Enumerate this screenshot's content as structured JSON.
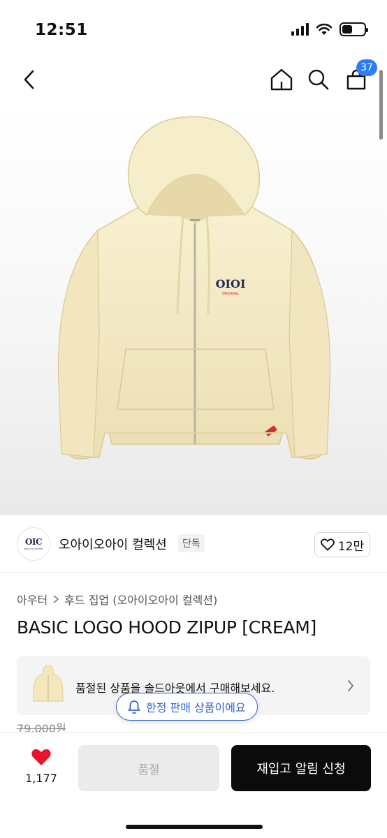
{
  "status_bar": {
    "time": "12:51"
  },
  "header": {
    "cart_count": "37"
  },
  "brand": {
    "logo_mark": "OIC",
    "logo_sub": "OIOI COLLECTION",
    "name": "오아이오아이 컬렉션",
    "tag": "단독",
    "likes": "12만"
  },
  "breadcrumb": {
    "category": "아우터",
    "subcategory": "후드 집업 (오아이오아이 컬렉션)"
  },
  "product": {
    "title": "BASIC LOGO HOOD ZIPUP [CREAM]",
    "original_price": "79,000원",
    "color": "#f6ecc8"
  },
  "soldout_notice": {
    "text": "품절된 상품을 솔드아웃에서 구매해보세요.",
    "limited_badge": "한정 판매 상품이에요"
  },
  "bottom_bar": {
    "wish_count": "1,177",
    "soldout_label": "품절",
    "restock_label": "재입고 알림 신청"
  },
  "colors": {
    "accent_blue": "#2d66e0",
    "badge_blue": "#2f7df6",
    "heart_red": "#e8132d",
    "cta_black": "#0b0b0b"
  }
}
